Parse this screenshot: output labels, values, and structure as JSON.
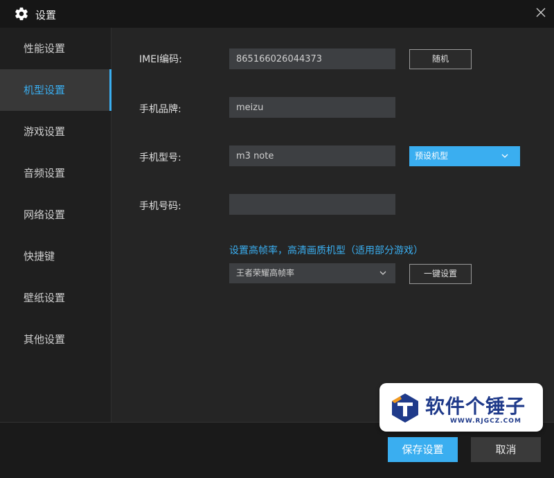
{
  "window": {
    "title": "设置",
    "icon": "gear-icon",
    "close_icon": "close-icon"
  },
  "sidebar": {
    "items": [
      {
        "label": "性能设置",
        "active": false
      },
      {
        "label": "机型设置",
        "active": true
      },
      {
        "label": "游戏设置",
        "active": false
      },
      {
        "label": "音频设置",
        "active": false
      },
      {
        "label": "网络设置",
        "active": false
      },
      {
        "label": "快捷键",
        "active": false
      },
      {
        "label": "壁纸设置",
        "active": false
      },
      {
        "label": "其他设置",
        "active": false
      }
    ]
  },
  "device": {
    "imei": {
      "label": "IMEI编码:",
      "value": "865166026044373",
      "random_label": "随机"
    },
    "brand": {
      "label": "手机品牌:",
      "value": "meizu"
    },
    "model": {
      "label": "手机型号:",
      "value": "m3 note",
      "preset_label": "预设机型"
    },
    "phone": {
      "label": "手机号码:",
      "value": ""
    },
    "high_fps": {
      "hint": "设置高帧率，高清画质机型（适用部分游戏）",
      "selected": "王者荣耀高帧率",
      "apply_label": "一键设置"
    }
  },
  "footer": {
    "save_label": "保存设置",
    "cancel_label": "取消"
  },
  "watermark": {
    "name": "软件个锤子",
    "url": "WWW.RJGCZ.COM"
  },
  "colors": {
    "accent": "#3aaef0",
    "background": "#252525",
    "sidebar": "#1f1f1f",
    "field": "#3d3f42"
  }
}
